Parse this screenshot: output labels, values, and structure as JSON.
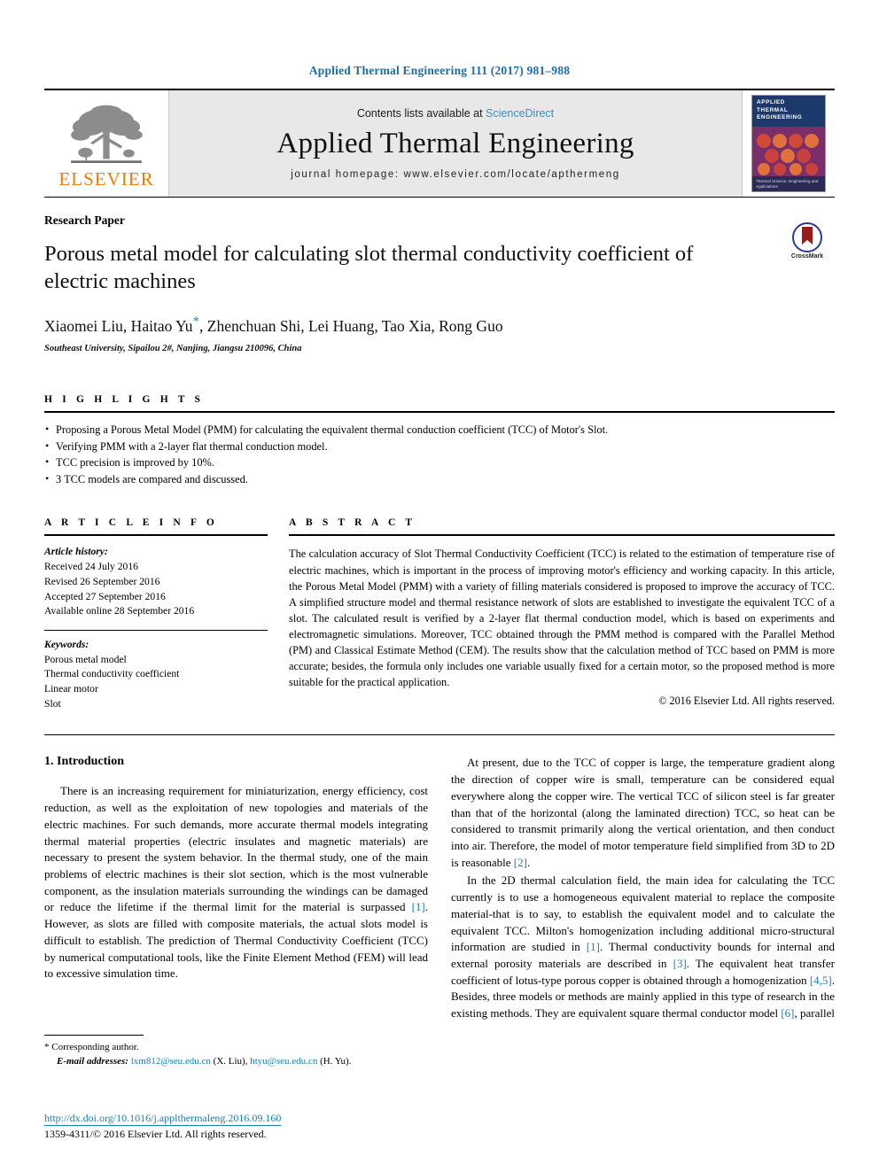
{
  "running_head": "Applied Thermal Engineering 111 (2017) 981–988",
  "masthead": {
    "publisher_name": "ELSEVIER",
    "contents_prefix": "Contents lists available at ",
    "contents_link": "ScienceDirect",
    "journal_title": "Applied Thermal Engineering",
    "homepage": "journal homepage: www.elsevier.com/locate/apthermeng",
    "cover": {
      "line1": "APPLIED",
      "line2": "THERMAL",
      "line3": "ENGINEERING",
      "footer": "Thermal Science, Engineering and Applications"
    }
  },
  "article": {
    "type_label": "Research Paper",
    "title": "Porous metal model for calculating slot thermal conductivity coefficient of electric machines",
    "crossmark_label": "CrossMark",
    "authors": "Xiaomei Liu, Haitao Yu",
    "authors_rest": ", Zhenchuan Shi, Lei Huang, Tao Xia, Rong Guo",
    "corresponding_marker": "*",
    "affiliation": "Southeast University, Sipailou 2#, Nanjing, Jiangsu 210096, China"
  },
  "highlights": {
    "heading": "H I G H L I G H T S",
    "items": [
      "Proposing a Porous Metal Model (PMM) for calculating the equivalent thermal conduction coefficient (TCC) of Motor's Slot.",
      "Verifying PMM with a 2-layer flat thermal conduction model.",
      "TCC precision is improved by 10%.",
      "3 TCC models are compared and discussed."
    ]
  },
  "article_info": {
    "heading": "A R T I C L E    I N F O",
    "history_label": "Article history:",
    "history": [
      "Received 24 July 2016",
      "Revised 26 September 2016",
      "Accepted 27 September 2016",
      "Available online 28 September 2016"
    ],
    "keywords_label": "Keywords:",
    "keywords": [
      "Porous metal model",
      "Thermal conductivity coefficient",
      "Linear motor",
      "Slot"
    ]
  },
  "abstract": {
    "heading": "A B S T R A C T",
    "text": "The calculation accuracy of Slot Thermal Conductivity Coefficient (TCC) is related to the estimation of temperature rise of electric machines, which is important in the process of improving motor's efficiency and working capacity. In this article, the Porous Metal Model (PMM) with a variety of filling materials considered is proposed to improve the accuracy of TCC. A simplified structure model and thermal resistance network of slots are established to investigate the equivalent TCC of a slot. The calculated result is verified by a 2-layer flat thermal conduction model, which is based on experiments and electromagnetic simulations. Moreover, TCC obtained through the PMM method is compared with the Parallel Method (PM) and Classical Estimate Method (CEM). The results show that the calculation method of TCC based on PMM is more accurate; besides, the formula only includes one variable usually fixed for a certain motor, so the proposed method is more suitable for the practical application.",
    "copyright": "© 2016 Elsevier Ltd. All rights reserved."
  },
  "body": {
    "section_heading": "1. Introduction",
    "left_para_1": "There is an increasing requirement for miniaturization, energy efficiency, cost reduction, as well as the exploitation of new topologies and materials of the electric machines. For such demands, more accurate thermal models integrating thermal material properties (electric insulates and magnetic materials) are necessary to present the system behavior. In the thermal study, one of the main problems of electric machines is their slot section, which is the most vulnerable component, as the insulation materials surrounding the windings can be damaged or reduce the lifetime if the thermal limit for the material is surpassed ",
    "left_para_1_ref": "[1]",
    "left_para_1_cont": ". However, as slots are filled with composite materials, the actual slots model is difficult to establish. The prediction of Thermal Conductivity Coefficient (TCC) by numerical computational tools, like the Finite Element Method (FEM) will lead to excessive simulation time.",
    "right_para_1": "At present, due to the TCC of copper is large, the temperature gradient along the direction of copper wire is small, temperature can be considered equal everywhere along the copper wire. The vertical TCC of silicon steel is far greater than that of the horizontal (along the laminated direction) TCC, so heat can be considered to transmit primarily along the vertical orientation, and then conduct into air. Therefore, the model of motor temperature field simplified from 3D to 2D is reasonable ",
    "right_para_1_ref": "[2]",
    "right_para_1_cont": ".",
    "right_para_2_a": "In the 2D thermal calculation field, the main idea for calculating the TCC currently is to use a homogeneous equivalent material to replace the composite material-that is to say, to establish the equivalent model and to calculate the equivalent TCC. Milton's homogenization including additional micro-structural information are studied in ",
    "right_para_2_ref1": "[1]",
    "right_para_2_b": ". Thermal conductivity bounds for internal and external porosity materials are described in ",
    "right_para_2_ref2": "[3]",
    "right_para_2_c": ". The equivalent heat transfer coefficient of lotus-type porous copper is obtained through a homogenization ",
    "right_para_2_ref3": "[4,5]",
    "right_para_2_d": ". Besides, three models or methods are mainly applied in this type of research in the existing methods. They are equivalent square thermal conductor model ",
    "right_para_2_ref4": "[6]",
    "right_para_2_e": ", parallel"
  },
  "footnote": {
    "corresponding_marker": "*",
    "corresponding_text": "Corresponding author.",
    "email_label": "E-mail addresses:",
    "email_1": "lxm812@seu.edu.cn",
    "email_1_owner": "(X. Liu),",
    "email_2": "htyu@seu.edu.cn",
    "email_2_owner": "(H. Yu)."
  },
  "footer": {
    "doi": "http://dx.doi.org/10.1016/j.applthermaleng.2016.09.160",
    "issn": "1359-4311/© 2016 Elsevier Ltd. All rights reserved."
  },
  "colors": {
    "link_blue": "#1a7fb5",
    "elsevier_orange": "#f07c00",
    "masthead_grey": "#e8e8e8"
  }
}
